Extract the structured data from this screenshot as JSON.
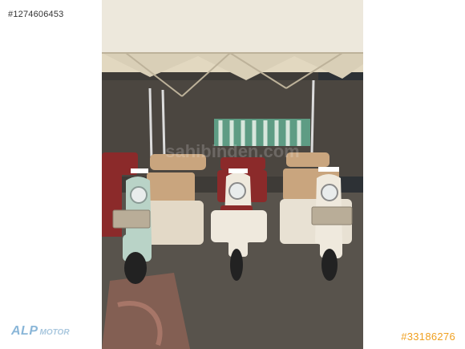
{
  "listing": {
    "photo_id": "#1274606453",
    "ad_number": "#33186276"
  },
  "dealer_logo": {
    "main": "ALP",
    "sub": "MOTOR"
  },
  "photo": {
    "description_colors": {
      "canopy": "#ede8dc",
      "canopy_inner": "#d9cfb7",
      "awning_green": "#5e9c84",
      "mint_scooter": "#b9d3c7",
      "cream_scooter": "#efe9dd",
      "seat_red": "#8b2a2a",
      "seat_tan": "#c9a57e",
      "ground": "#555049"
    }
  }
}
